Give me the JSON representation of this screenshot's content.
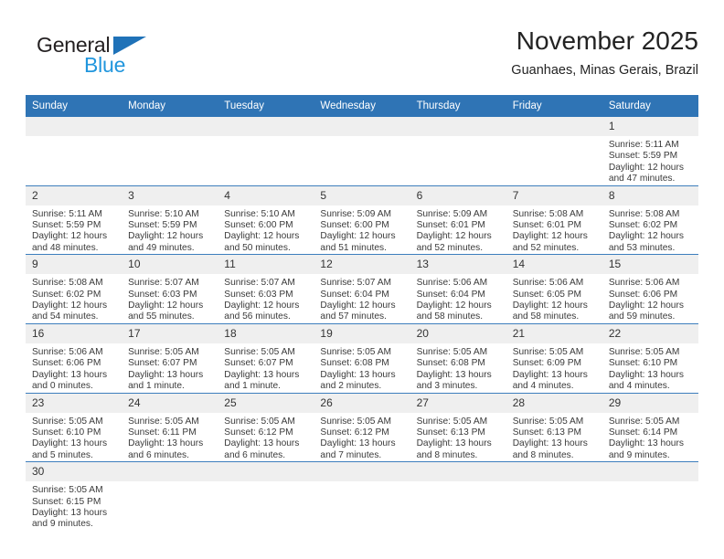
{
  "brand": {
    "name_primary": "General",
    "name_secondary": "Blue",
    "triangle_icon": "triangle-icon",
    "accent_blue": "#2f74b5",
    "logo_blue": "#2196dd"
  },
  "header": {
    "title": "November 2025",
    "subtitle": "Guanhaes, Minas Gerais, Brazil"
  },
  "calendar": {
    "weekday_headers": [
      "Sunday",
      "Monday",
      "Tuesday",
      "Wednesday",
      "Thursday",
      "Friday",
      "Saturday"
    ],
    "weeks": [
      [
        {
          "day": "",
          "empty": true
        },
        {
          "day": "",
          "empty": true
        },
        {
          "day": "",
          "empty": true
        },
        {
          "day": "",
          "empty": true
        },
        {
          "day": "",
          "empty": true
        },
        {
          "day": "",
          "empty": true
        },
        {
          "day": "1",
          "sunrise": "Sunrise: 5:11 AM",
          "sunset": "Sunset: 5:59 PM",
          "daylight_1": "Daylight: 12 hours",
          "daylight_2": "and 47 minutes."
        }
      ],
      [
        {
          "day": "2",
          "sunrise": "Sunrise: 5:11 AM",
          "sunset": "Sunset: 5:59 PM",
          "daylight_1": "Daylight: 12 hours",
          "daylight_2": "and 48 minutes."
        },
        {
          "day": "3",
          "sunrise": "Sunrise: 5:10 AM",
          "sunset": "Sunset: 5:59 PM",
          "daylight_1": "Daylight: 12 hours",
          "daylight_2": "and 49 minutes."
        },
        {
          "day": "4",
          "sunrise": "Sunrise: 5:10 AM",
          "sunset": "Sunset: 6:00 PM",
          "daylight_1": "Daylight: 12 hours",
          "daylight_2": "and 50 minutes."
        },
        {
          "day": "5",
          "sunrise": "Sunrise: 5:09 AM",
          "sunset": "Sunset: 6:00 PM",
          "daylight_1": "Daylight: 12 hours",
          "daylight_2": "and 51 minutes."
        },
        {
          "day": "6",
          "sunrise": "Sunrise: 5:09 AM",
          "sunset": "Sunset: 6:01 PM",
          "daylight_1": "Daylight: 12 hours",
          "daylight_2": "and 52 minutes."
        },
        {
          "day": "7",
          "sunrise": "Sunrise: 5:08 AM",
          "sunset": "Sunset: 6:01 PM",
          "daylight_1": "Daylight: 12 hours",
          "daylight_2": "and 52 minutes."
        },
        {
          "day": "8",
          "sunrise": "Sunrise: 5:08 AM",
          "sunset": "Sunset: 6:02 PM",
          "daylight_1": "Daylight: 12 hours",
          "daylight_2": "and 53 minutes."
        }
      ],
      [
        {
          "day": "9",
          "sunrise": "Sunrise: 5:08 AM",
          "sunset": "Sunset: 6:02 PM",
          "daylight_1": "Daylight: 12 hours",
          "daylight_2": "and 54 minutes."
        },
        {
          "day": "10",
          "sunrise": "Sunrise: 5:07 AM",
          "sunset": "Sunset: 6:03 PM",
          "daylight_1": "Daylight: 12 hours",
          "daylight_2": "and 55 minutes."
        },
        {
          "day": "11",
          "sunrise": "Sunrise: 5:07 AM",
          "sunset": "Sunset: 6:03 PM",
          "daylight_1": "Daylight: 12 hours",
          "daylight_2": "and 56 minutes."
        },
        {
          "day": "12",
          "sunrise": "Sunrise: 5:07 AM",
          "sunset": "Sunset: 6:04 PM",
          "daylight_1": "Daylight: 12 hours",
          "daylight_2": "and 57 minutes."
        },
        {
          "day": "13",
          "sunrise": "Sunrise: 5:06 AM",
          "sunset": "Sunset: 6:04 PM",
          "daylight_1": "Daylight: 12 hours",
          "daylight_2": "and 58 minutes."
        },
        {
          "day": "14",
          "sunrise": "Sunrise: 5:06 AM",
          "sunset": "Sunset: 6:05 PM",
          "daylight_1": "Daylight: 12 hours",
          "daylight_2": "and 58 minutes."
        },
        {
          "day": "15",
          "sunrise": "Sunrise: 5:06 AM",
          "sunset": "Sunset: 6:06 PM",
          "daylight_1": "Daylight: 12 hours",
          "daylight_2": "and 59 minutes."
        }
      ],
      [
        {
          "day": "16",
          "sunrise": "Sunrise: 5:06 AM",
          "sunset": "Sunset: 6:06 PM",
          "daylight_1": "Daylight: 13 hours",
          "daylight_2": "and 0 minutes."
        },
        {
          "day": "17",
          "sunrise": "Sunrise: 5:05 AM",
          "sunset": "Sunset: 6:07 PM",
          "daylight_1": "Daylight: 13 hours",
          "daylight_2": "and 1 minute."
        },
        {
          "day": "18",
          "sunrise": "Sunrise: 5:05 AM",
          "sunset": "Sunset: 6:07 PM",
          "daylight_1": "Daylight: 13 hours",
          "daylight_2": "and 1 minute."
        },
        {
          "day": "19",
          "sunrise": "Sunrise: 5:05 AM",
          "sunset": "Sunset: 6:08 PM",
          "daylight_1": "Daylight: 13 hours",
          "daylight_2": "and 2 minutes."
        },
        {
          "day": "20",
          "sunrise": "Sunrise: 5:05 AM",
          "sunset": "Sunset: 6:08 PM",
          "daylight_1": "Daylight: 13 hours",
          "daylight_2": "and 3 minutes."
        },
        {
          "day": "21",
          "sunrise": "Sunrise: 5:05 AM",
          "sunset": "Sunset: 6:09 PM",
          "daylight_1": "Daylight: 13 hours",
          "daylight_2": "and 4 minutes."
        },
        {
          "day": "22",
          "sunrise": "Sunrise: 5:05 AM",
          "sunset": "Sunset: 6:10 PM",
          "daylight_1": "Daylight: 13 hours",
          "daylight_2": "and 4 minutes."
        }
      ],
      [
        {
          "day": "23",
          "sunrise": "Sunrise: 5:05 AM",
          "sunset": "Sunset: 6:10 PM",
          "daylight_1": "Daylight: 13 hours",
          "daylight_2": "and 5 minutes."
        },
        {
          "day": "24",
          "sunrise": "Sunrise: 5:05 AM",
          "sunset": "Sunset: 6:11 PM",
          "daylight_1": "Daylight: 13 hours",
          "daylight_2": "and 6 minutes."
        },
        {
          "day": "25",
          "sunrise": "Sunrise: 5:05 AM",
          "sunset": "Sunset: 6:12 PM",
          "daylight_1": "Daylight: 13 hours",
          "daylight_2": "and 6 minutes."
        },
        {
          "day": "26",
          "sunrise": "Sunrise: 5:05 AM",
          "sunset": "Sunset: 6:12 PM",
          "daylight_1": "Daylight: 13 hours",
          "daylight_2": "and 7 minutes."
        },
        {
          "day": "27",
          "sunrise": "Sunrise: 5:05 AM",
          "sunset": "Sunset: 6:13 PM",
          "daylight_1": "Daylight: 13 hours",
          "daylight_2": "and 8 minutes."
        },
        {
          "day": "28",
          "sunrise": "Sunrise: 5:05 AM",
          "sunset": "Sunset: 6:13 PM",
          "daylight_1": "Daylight: 13 hours",
          "daylight_2": "and 8 minutes."
        },
        {
          "day": "29",
          "sunrise": "Sunrise: 5:05 AM",
          "sunset": "Sunset: 6:14 PM",
          "daylight_1": "Daylight: 13 hours",
          "daylight_2": "and 9 minutes."
        }
      ],
      [
        {
          "day": "30",
          "sunrise": "Sunrise: 5:05 AM",
          "sunset": "Sunset: 6:15 PM",
          "daylight_1": "Daylight: 13 hours",
          "daylight_2": "and 9 minutes."
        },
        {
          "day": "",
          "empty": true
        },
        {
          "day": "",
          "empty": true
        },
        {
          "day": "",
          "empty": true
        },
        {
          "day": "",
          "empty": true
        },
        {
          "day": "",
          "empty": true
        },
        {
          "day": "",
          "empty": true
        }
      ]
    ]
  }
}
